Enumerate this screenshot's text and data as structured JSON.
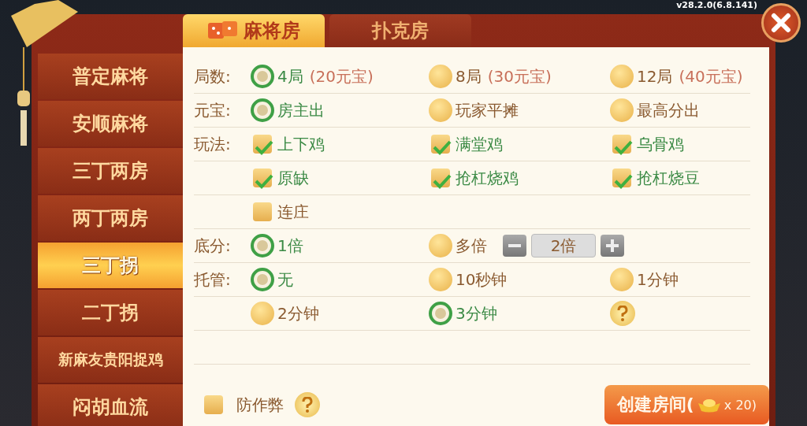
{
  "version": "v28.2.0(6.8.141)",
  "tabs": [
    {
      "label": "麻将房",
      "selected": true
    },
    {
      "label": "扑克房",
      "selected": false
    }
  ],
  "sidebar": {
    "items": [
      {
        "label": "普定麻将",
        "selected": false
      },
      {
        "label": "安顺麻将",
        "selected": false
      },
      {
        "label": "三丁两房",
        "selected": false
      },
      {
        "label": "两丁两房",
        "selected": false
      },
      {
        "label": "三丁拐",
        "selected": true
      },
      {
        "label": "二丁拐",
        "selected": false
      },
      {
        "label": "新麻友贵阳捉鸡",
        "selected": false
      },
      {
        "label": "闷胡血流",
        "selected": false
      }
    ]
  },
  "rows": [
    {
      "label": "局数:",
      "options": [
        {
          "kind": "radio",
          "text": "4局",
          "note": "(20元宝)",
          "selected": true
        },
        {
          "kind": "radio",
          "text": "8局",
          "note": "(30元宝)",
          "selected": false
        },
        {
          "kind": "radio",
          "text": "12局",
          "note": "(40元宝)",
          "selected": false
        }
      ]
    },
    {
      "label": "元宝:",
      "options": [
        {
          "kind": "radio",
          "text": "房主出",
          "selected": true
        },
        {
          "kind": "radio",
          "text": "玩家平摊",
          "selected": false
        },
        {
          "kind": "radio",
          "text": "最高分出",
          "selected": false
        }
      ]
    },
    {
      "label": "玩法:",
      "options": [
        {
          "kind": "checkbox",
          "text": "上下鸡",
          "checked": true
        },
        {
          "kind": "checkbox",
          "text": "满堂鸡",
          "checked": true
        },
        {
          "kind": "checkbox",
          "text": "乌骨鸡",
          "checked": true
        }
      ]
    },
    {
      "options": [
        {
          "kind": "checkbox",
          "text": "原缺",
          "checked": true
        },
        {
          "kind": "checkbox",
          "text": "抢杠烧鸡",
          "checked": true
        },
        {
          "kind": "checkbox",
          "text": "抢杠烧豆",
          "checked": true
        }
      ]
    },
    {
      "options": [
        {
          "kind": "checkbox",
          "text": "连庄",
          "checked": false
        }
      ]
    },
    {
      "label": "底分:",
      "options": [
        {
          "kind": "radio",
          "text": "1倍",
          "selected": true
        },
        {
          "kind": "radio",
          "text": "多倍",
          "selected": false,
          "stepper": "2倍"
        }
      ]
    },
    {
      "label": "托管:",
      "options": [
        {
          "kind": "radio",
          "text": "无",
          "selected": true
        },
        {
          "kind": "radio",
          "text": "10秒钟",
          "selected": false
        },
        {
          "kind": "radio",
          "text": "1分钟",
          "selected": false
        }
      ]
    },
    {
      "options": [
        {
          "kind": "radio",
          "text": "2分钟",
          "selected": false
        },
        {
          "kind": "radio",
          "text": "3分钟",
          "selected": true
        },
        {
          "kind": "help"
        }
      ]
    },
    {
      "options": []
    }
  ],
  "anti_cheat": {
    "text": "防作弊",
    "checked": false
  },
  "create_button": {
    "text": "创建房间(",
    "cost": "x 20)"
  }
}
